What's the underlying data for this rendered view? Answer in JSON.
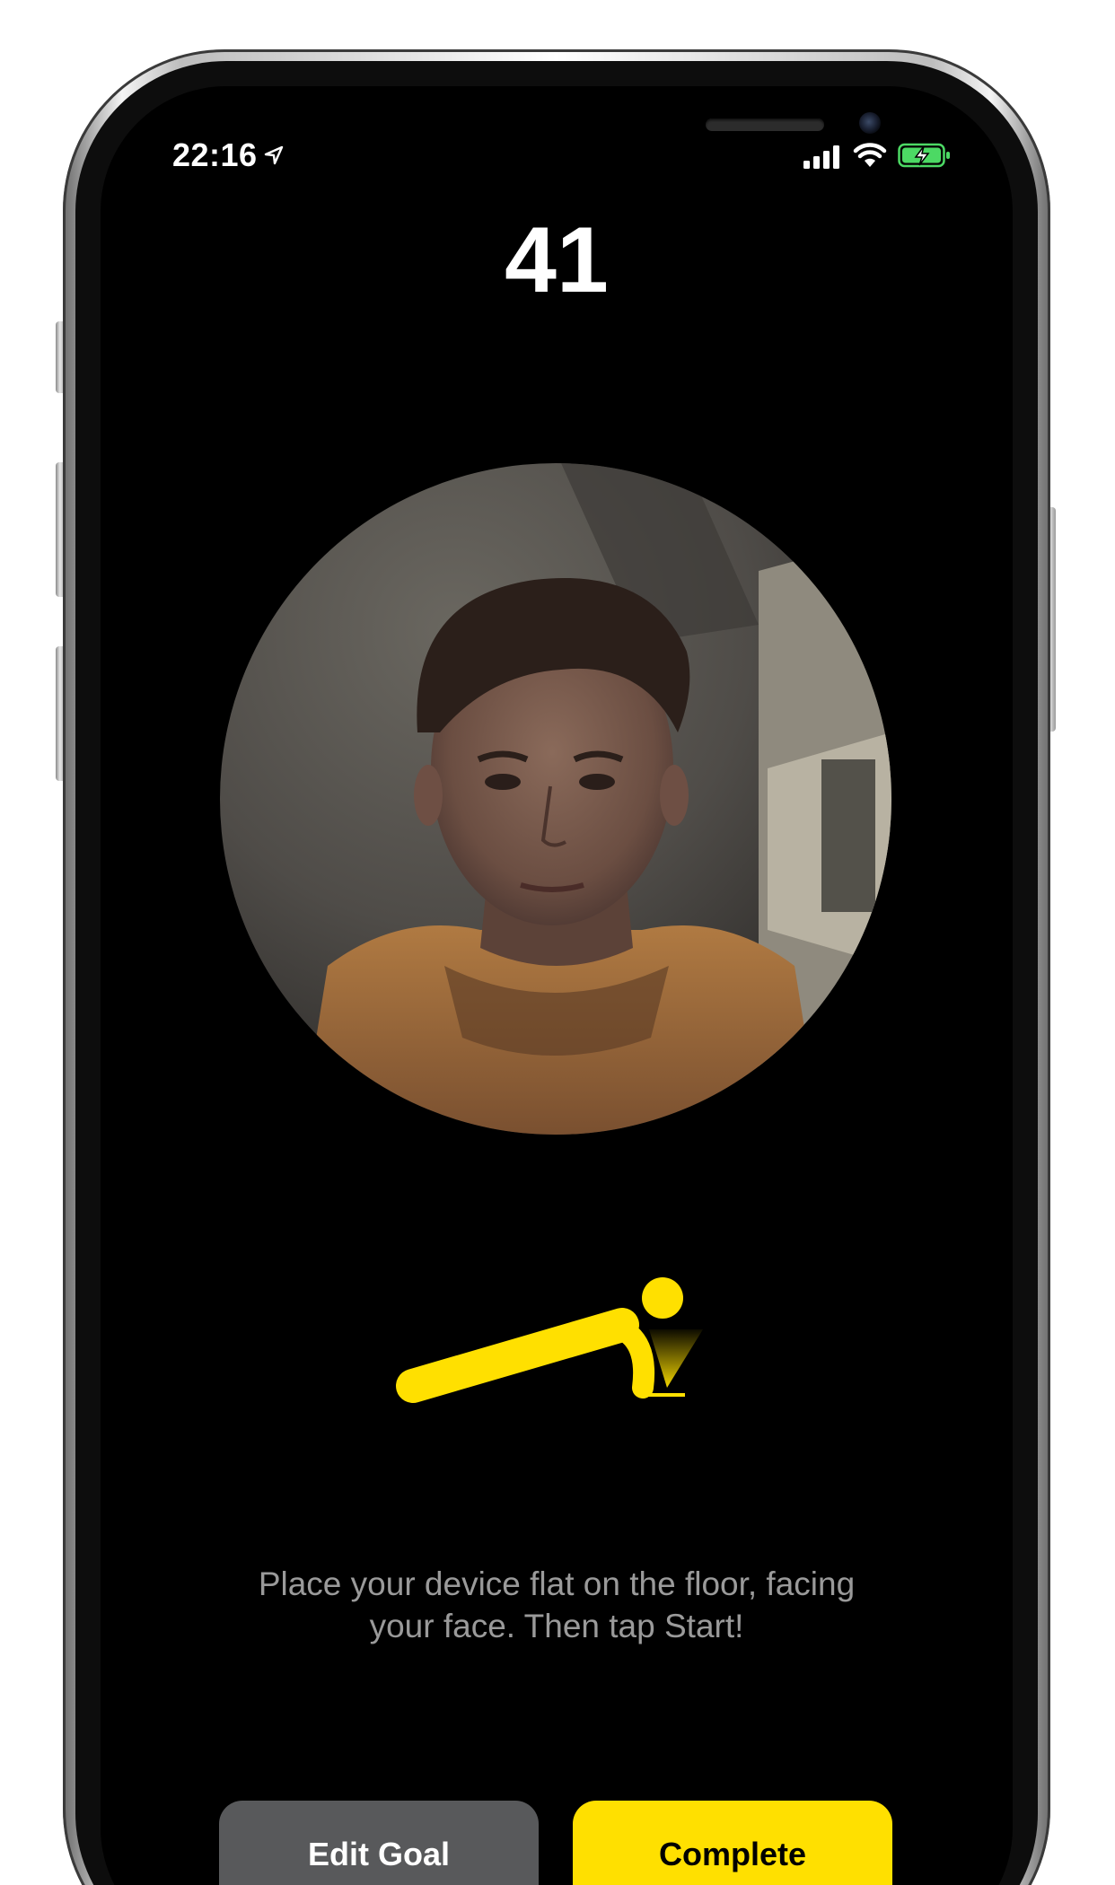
{
  "status_bar": {
    "time": "22:16",
    "icons": [
      "location-arrow-icon",
      "cellular-signal-icon",
      "wifi-icon",
      "battery-charging-icon"
    ]
  },
  "counter": {
    "value": "41"
  },
  "camera_preview": {
    "description_icon": "front-camera-preview"
  },
  "illustration": {
    "icon": "pushup-figure-icon"
  },
  "instruction": {
    "line1": "Place your device flat on the floor, facing",
    "line2": "your face. Then tap Start!"
  },
  "buttons": {
    "edit_goal": "Edit Goal",
    "complete": "Complete"
  },
  "colors": {
    "accent": "#ffe000",
    "secondary_button": "#58595b",
    "background": "#000000",
    "instruction_text": "#9a9a9a",
    "battery_fill": "#4cd964"
  }
}
